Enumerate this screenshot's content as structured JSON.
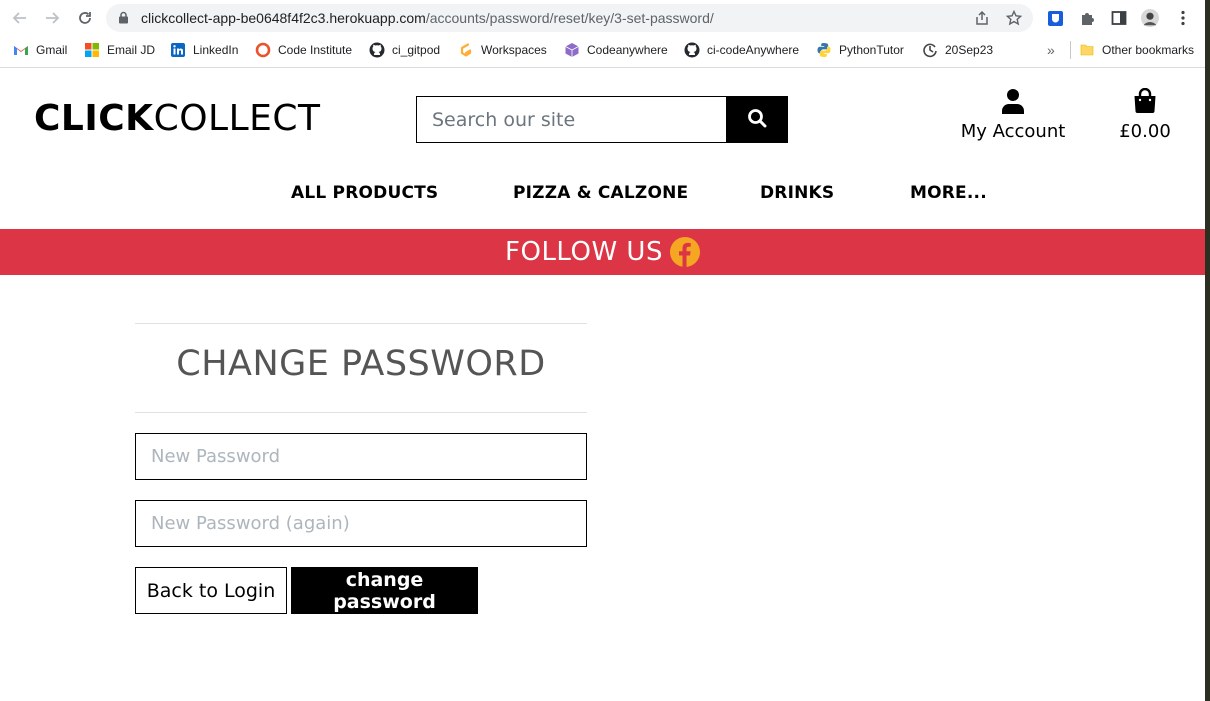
{
  "browser": {
    "url_host": "clickcollect-app-be0648f4f2c3.herokuapp.com",
    "url_path": "/accounts/password/reset/key/3-set-password/",
    "bookmarks": [
      {
        "label": "Gmail",
        "icon": "gmail-icon"
      },
      {
        "label": "Email JD",
        "icon": "microsoft-icon"
      },
      {
        "label": "LinkedIn",
        "icon": "linkedin-icon"
      },
      {
        "label": "Code Institute",
        "icon": "code-institute-icon"
      },
      {
        "label": "ci_gitpod",
        "icon": "github-icon"
      },
      {
        "label": "Workspaces",
        "icon": "gitpod-icon"
      },
      {
        "label": "Codeanywhere",
        "icon": "codeanywhere-icon"
      },
      {
        "label": "ci-codeAnywhere",
        "icon": "github-icon"
      },
      {
        "label": "PythonTutor",
        "icon": "python-icon"
      },
      {
        "label": "20Sep23",
        "icon": "swirl-icon"
      }
    ],
    "more_bookmarks": "»",
    "other_bookmarks": "Other bookmarks"
  },
  "site": {
    "logo_bold": "CLICK",
    "logo_light": "COLLECT",
    "search_placeholder": "Search our site",
    "account_label": "My Account",
    "bag_total": "£0.00",
    "nav": [
      "ALL PRODUCTS",
      "PIZZA & CALZONE",
      "DRINKS",
      "MORE..."
    ],
    "banner_text": "FOLLOW US",
    "accent_color": "#dc3545",
    "facebook_color": "#f5a623"
  },
  "form": {
    "title": "CHANGE PASSWORD",
    "password1_placeholder": "New Password",
    "password2_placeholder": "New Password (again)",
    "back_label": "Back to Login",
    "submit_label": "change password"
  }
}
